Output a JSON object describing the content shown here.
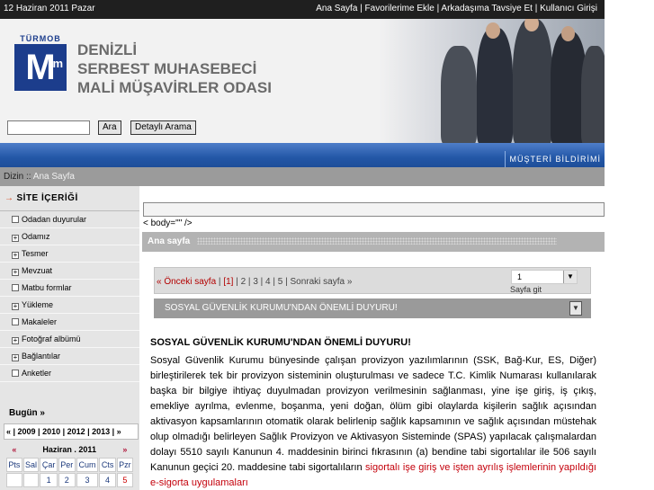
{
  "topbar": {
    "date": "12 Haziran 2011 Pazar",
    "links": [
      "Ana Sayfa",
      "Favorilerime Ekle",
      "Arkadaşıma Tavsiye Et",
      "Kullanıcı Girişi"
    ],
    "separator": " | "
  },
  "logo": {
    "top_text": "TÜRMOB",
    "mark": "M",
    "sup": "m"
  },
  "org_name": [
    "DENİZLİ",
    "SERBEST MUHASEBECİ",
    "MALİ MÜŞAVİRLER ODASI"
  ],
  "search": {
    "value": "",
    "button": "Ara",
    "detail_button": "Detaylı Arama"
  },
  "bluebar": {
    "right_link": "MÜŞTERİ BİLDİRİMİ"
  },
  "breadcrumb": {
    "label": "Dizin ::",
    "current": "Ana Sayfa"
  },
  "sidebar": {
    "title": "SİTE İÇERİĞİ",
    "items": [
      {
        "label": "Odadan duyurular",
        "icon": "box-empty",
        "mark": ""
      },
      {
        "label": "Odamız",
        "icon": "box-plus",
        "mark": "+"
      },
      {
        "label": "Tesmer",
        "icon": "box-plus",
        "mark": "+"
      },
      {
        "label": "Mevzuat",
        "icon": "box-plus",
        "mark": "+"
      },
      {
        "label": "Matbu formlar",
        "icon": "box-empty",
        "mark": ""
      },
      {
        "label": "Yükleme",
        "icon": "box-plus",
        "mark": "+"
      },
      {
        "label": "Makaleler",
        "icon": "box-empty",
        "mark": ""
      },
      {
        "label": "Fotoğraf albümü",
        "icon": "box-plus",
        "mark": "+"
      },
      {
        "label": "Bağlantılar",
        "icon": "box-plus",
        "mark": "+"
      },
      {
        "label": "Anketler",
        "icon": "box-empty",
        "mark": ""
      }
    ]
  },
  "calendar": {
    "today_link": "Bugün »",
    "years": "« | 2009 | 2010 | 2012 | 2013 | »",
    "prev": "«",
    "month": "Haziran . 2011",
    "next": "»",
    "day_names": [
      "Pts",
      "Sal",
      "Çar",
      "Per",
      "Cum",
      "Cts",
      "Pzr"
    ],
    "first_week": [
      "",
      "",
      "1",
      "2",
      "3",
      "4",
      "5"
    ]
  },
  "main": {
    "body_text": "< body=\"\" />",
    "section_title": "Ana sayfa",
    "pager": {
      "prev": "« Önceki sayfa",
      "current": "[1]",
      "pages": [
        "2",
        "3",
        "4",
        "5"
      ],
      "next": "Sonraki sayfa »",
      "select_value": "1",
      "go_label": "Sayfa git"
    },
    "dropdown_value": "SOSYAL GÜVENLİK KURUMU'NDAN ÖNEMLİ DUYURU!",
    "article": {
      "title": "SOSYAL GÜVENLİK KURUMU'NDAN ÖNEMLİ DUYURU!",
      "body": "Sosyal Güvenlik Kurumu bünyesinde çalışan provizyon yazılımlarının (SSK, Bağ-Kur, ES, Diğer) birleştirilerek tek bir provizyon sisteminin oluşturulması ve sadece T.C. Kimlik Numarası kullanılarak başka bir bilgiye ihtiyaç duyulmadan provizyon verilmesinin sağlanması, yine işe giriş, iş çıkış, emekliye ayrılma, evlenme, boşanma, yeni doğan, ölüm gibi olaylarda kişilerin sağlık açısından aktivasyon kapsamlarının otomatik olarak belirlenip sağlık kapsamının ve sağlık açısından müstehak olup olmadığı belirleyen Sağlık Provizyon ve Aktivasyon Sisteminde (SPAS) yapılacak çalışmalardan dolayı 5510 sayılı Kanunun 4. maddesinin birinci fıkrasının (a) bendine tabi sigortalılar ile 506 sayılı Kanunun geçici 20. maddesine tabi sigortalıların ",
      "red_text": "sigortalı işe giriş ve işten ayrılış işlemlerinin yapıldığı e-sigorta uygulamaları"
    }
  },
  "colors": {
    "topbar": "#1f1f1f",
    "brand_blue": "#1c3d8c",
    "bluebar": "#2357a7",
    "link_red": "#c4000b"
  }
}
